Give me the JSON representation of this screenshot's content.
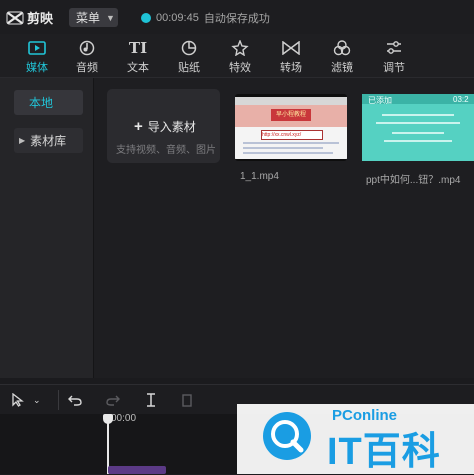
{
  "app": {
    "name": "剪映"
  },
  "menu": {
    "label": "菜单"
  },
  "save_status": {
    "time": "00:09:45",
    "text": "自动保存成功"
  },
  "toolbar": {
    "tabs": [
      {
        "label": "媒体",
        "icon": "media-icon",
        "active": true
      },
      {
        "label": "音频",
        "icon": "audio-icon"
      },
      {
        "label": "文本",
        "icon": "text-icon"
      },
      {
        "label": "贴纸",
        "icon": "sticker-icon"
      },
      {
        "label": "特效",
        "icon": "effects-icon"
      },
      {
        "label": "转场",
        "icon": "transition-icon"
      },
      {
        "label": "滤镜",
        "icon": "filter-icon"
      },
      {
        "label": "调节",
        "icon": "adjust-icon"
      }
    ],
    "text_icon_glyph": "TI"
  },
  "sidebar": {
    "items": [
      {
        "label": "本地",
        "active": true
      },
      {
        "label": "素材库"
      }
    ]
  },
  "import": {
    "label": "导入素材",
    "hint": "支持视频、音频、图片"
  },
  "thumb1": {
    "banner": "早小程教程",
    "url": "http://xx.cnwl.xyz/"
  },
  "thumb2": {
    "label": "已添加",
    "time": "03:2"
  },
  "media_items": [
    {
      "filename": "1_1.mp4"
    },
    {
      "filename": "ppt中如何...钮？.mp4"
    }
  ],
  "timeline": {
    "ruler_time": "00:00"
  },
  "watermark": {
    "brand": "PConline",
    "text": "IT百科"
  },
  "colors": {
    "accent": "#21c5d8",
    "watermark": "#1a9de3",
    "clip": "#5b3a86"
  }
}
